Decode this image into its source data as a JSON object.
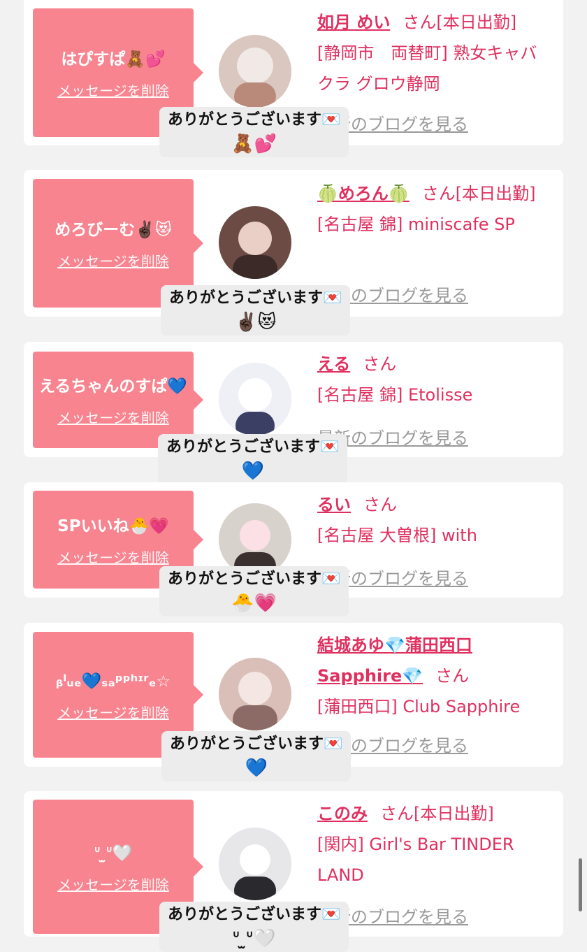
{
  "messages": [
    {
      "sender": "はぴすぱ🧸💕",
      "delete_label": "メッセージを削除",
      "cast_name": "如月 めい",
      "honorific": "さん",
      "status": "[本日出勤]",
      "shop": "[静岡市　両替町] 熟女キャバクラ グロウ静岡",
      "blog_label": "最新のブログを見る",
      "thanks": "ありがとうございます💌",
      "thanks_emoji": "🧸💕",
      "avatar_colors": [
        "#d9c7c0",
        "#f1e9e6",
        "#b98a7a"
      ]
    },
    {
      "sender": "めろびーむ✌🏿😻",
      "delete_label": "メッセージを削除",
      "cast_name": "🍈めろん🍈",
      "honorific": "さん",
      "status": "[本日出勤]",
      "shop": "[名古屋 錦] miniscafe SP",
      "blog_label": "最新のブログを見る",
      "thanks": "ありがとうございます💌",
      "thanks_emoji": "✌🏿😻",
      "avatar_colors": [
        "#6b4b44",
        "#e9cfc6",
        "#3b2a27"
      ]
    },
    {
      "sender": "えるちゃんのすぱ💙",
      "delete_label": "メッセージを削除",
      "cast_name": "える",
      "honorific": "さん",
      "status": "",
      "shop": "[名古屋 錦] Etolisse",
      "blog_label": "最新のブログを見る",
      "thanks": "ありがとうございます💌",
      "thanks_emoji": "💙",
      "avatar_colors": [
        "#eef0f6",
        "#ffffff",
        "#3b3f63"
      ]
    },
    {
      "sender": "SPいいね🐣💗",
      "delete_label": "メッセージを削除",
      "cast_name": "るい",
      "honorific": "さん",
      "status": "",
      "shop": "[名古屋 大曽根] with",
      "blog_label": "最新のブログを見る",
      "thanks": "ありがとうございます💌",
      "thanks_emoji": "🐣💗",
      "avatar_colors": [
        "#d8d2cc",
        "#fbe0e6",
        "#3a3030"
      ]
    },
    {
      "sender": "ᵦˡᵤₑ💙ₛₐᵖᵖʰᶦʳₑ☆",
      "delete_label": "メッセージを削除",
      "cast_name": "結城あゆ💎蒲田西口Sapphire💎",
      "honorific": "さん",
      "status": "",
      "shop": "[蒲田西口] Club Sapphire",
      "blog_label": "最新のブログを見る",
      "thanks": "ありがとうございます💌",
      "thanks_emoji": "💙",
      "avatar_colors": [
        "#d9bfb8",
        "#f4e6e2",
        "#8c6b66"
      ]
    },
    {
      "sender": "ᐡ ̫ᐡ🤍",
      "delete_label": "メッセージを削除",
      "cast_name": "このみ",
      "honorific": "さん",
      "status": "[本日出勤]",
      "shop": "[関内] Girl's Bar TINDER LAND",
      "blog_label": "最新のブログを見る",
      "thanks": "ありがとうございます💌",
      "thanks_emoji": "ᐡ ̫ᐡ🤍",
      "avatar_colors": [
        "#e7e7ea",
        "#ffffff",
        "#2a2a2e"
      ]
    }
  ],
  "colors": {
    "bubble": "#f8848f",
    "link": "#e0305f",
    "muted": "#9a9a9a"
  }
}
